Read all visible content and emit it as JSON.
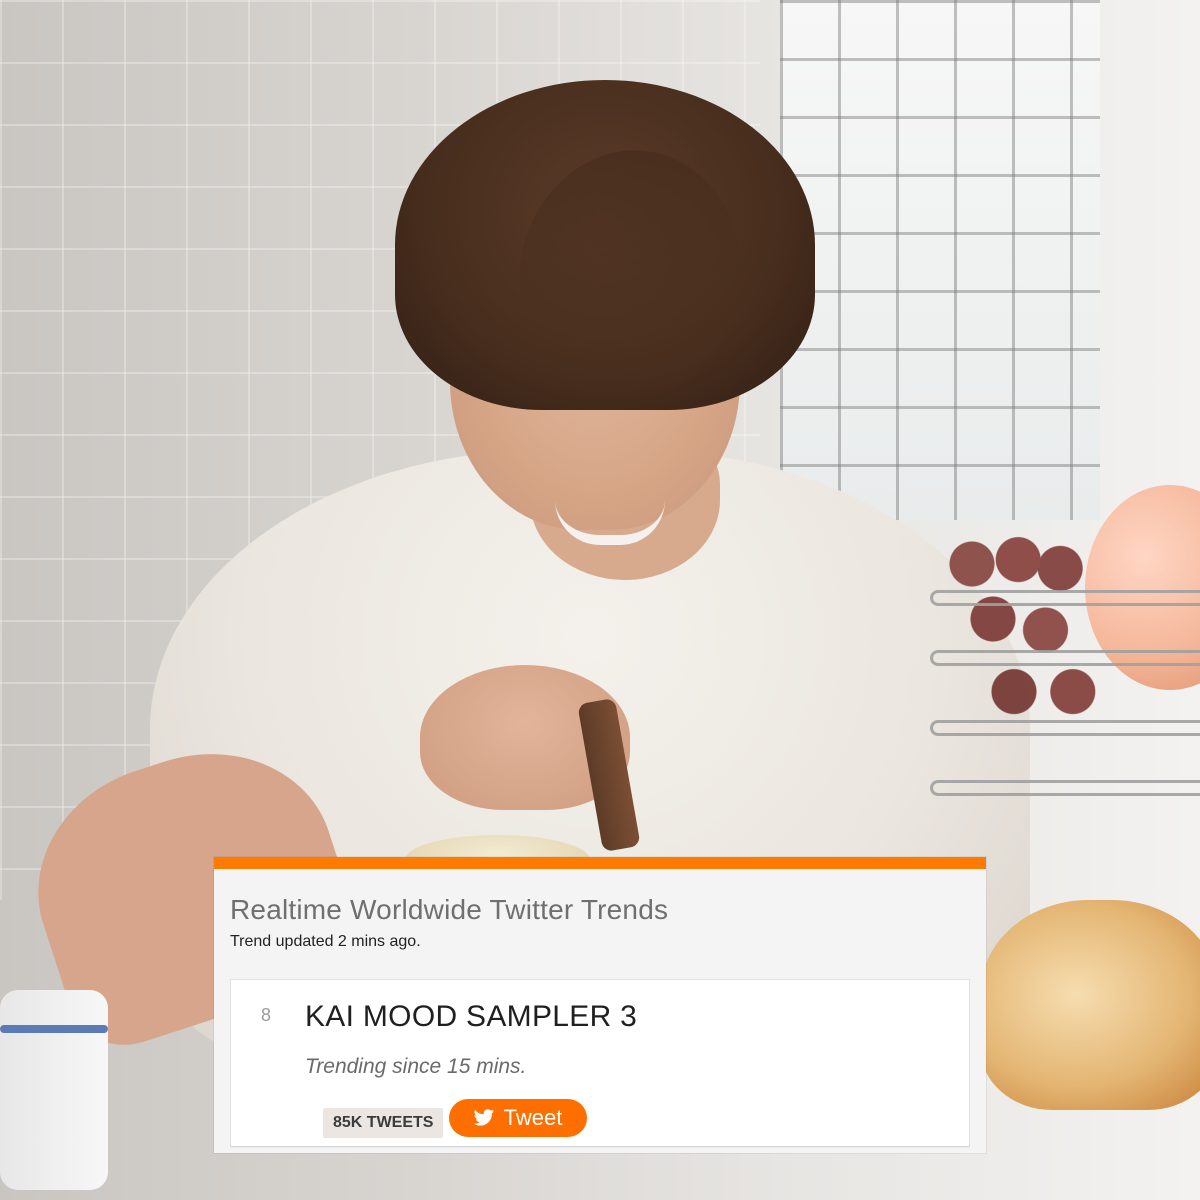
{
  "card": {
    "title": "Realtime Worldwide Twitter Trends",
    "updated": "Trend updated 2 mins ago."
  },
  "trend": {
    "rank": "8",
    "name": "KAI MOOD SAMPLER 3",
    "since": "Trending since 15 mins.",
    "count_label": "85K TWEETS",
    "button_label": "Tweet",
    "button_icon": "twitter-bird-icon"
  },
  "colors": {
    "accent": "#ff7a00",
    "button": "#ff6f00"
  }
}
